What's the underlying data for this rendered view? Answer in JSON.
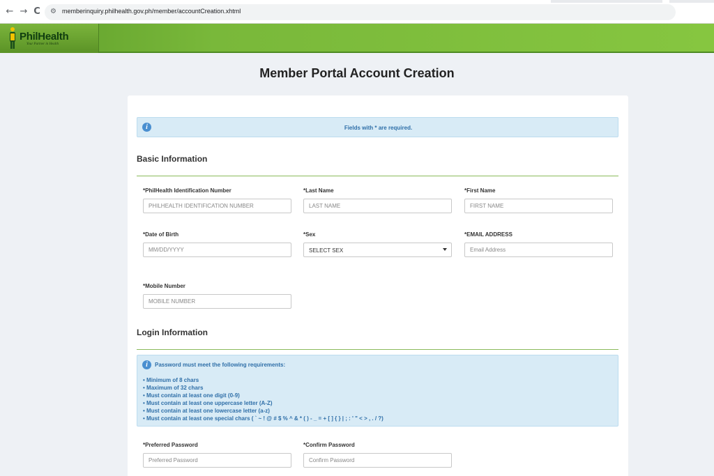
{
  "browser": {
    "back_icon": "←",
    "forward_icon": "→",
    "reload_icon": "C",
    "site_info_icon": "⚙",
    "url": "memberinquiry.philhealth.gov.ph/member/accountCreation.xhtml"
  },
  "header": {
    "logo_text": "PhilHealth",
    "logo_tagline": "Your Partner in Health"
  },
  "page": {
    "title": "Member Portal Account Creation"
  },
  "notice": {
    "icon": "i",
    "text": "Fields with * are required."
  },
  "basic_info": {
    "heading": "Basic Information",
    "pin_label": "*PhilHealth Identification Number",
    "pin_placeholder": "PHILHEALTH IDENTIFICATION NUMBER",
    "last_name_label": "*Last Name",
    "last_name_placeholder": "LAST NAME",
    "first_name_label": "*First Name",
    "first_name_placeholder": "FIRST NAME",
    "dob_label": "*Date of Birth",
    "dob_placeholder": "MM/DD/YYYY",
    "sex_label": "*Sex",
    "sex_value": "SELECT SEX",
    "email_label": "*EMAIL ADDRESS",
    "email_placeholder": "Email Address",
    "mobile_label": "*Mobile Number",
    "mobile_placeholder": "MOBILE NUMBER"
  },
  "login_info": {
    "heading": "Login Information",
    "password_notice": {
      "icon": "i",
      "title": "Password must meet the following requirements:",
      "requirements": [
        "• Minimum of 8 chars",
        "• Maximum of 32 chars",
        "• Must contain at least one digit (0-9)",
        "• Must contain at least one uppercase letter (A-Z)",
        "• Must contain at least one lowercase letter (a-z)",
        "• Must contain at least one special chars ( ` ~ ! @ # $ % ^ & * ( ) - _ = + [ ] { } | ; : ' \" < > , . / ?)"
      ]
    },
    "password_label": "*Preferred Password",
    "password_placeholder": "Preferred Password",
    "confirm_label": "*Confirm Password",
    "confirm_placeholder": "Confirm Password"
  },
  "colors": {
    "header_green": "#79b83a",
    "info_blue": "#2f6fa8",
    "info_bg": "#d8ebf6",
    "rule_green": "#8aba5a"
  }
}
